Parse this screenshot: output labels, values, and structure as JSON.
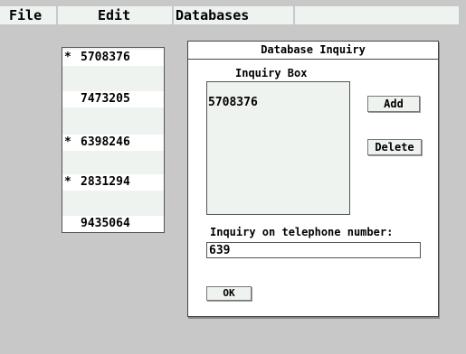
{
  "menubar": {
    "items": [
      {
        "label": "File"
      },
      {
        "label": "Edit"
      },
      {
        "label": "Databases"
      }
    ]
  },
  "phone_list": {
    "rows": [
      {
        "marker": "*",
        "number": "5708376"
      },
      {
        "marker": "",
        "number": "7473205"
      },
      {
        "marker": "*",
        "number": "6398246"
      },
      {
        "marker": "*",
        "number": "2831294"
      },
      {
        "marker": "",
        "number": "9435064"
      }
    ]
  },
  "dialog": {
    "title": "Database Inquiry",
    "inquiry_box_label": "Inquiry Box",
    "inquiry_items": [
      "5708376"
    ],
    "add_label": "Add",
    "delete_label": "Delete",
    "phone_label": "Inquiry on telephone number:",
    "phone_value": "639",
    "ok_label": "OK"
  }
}
